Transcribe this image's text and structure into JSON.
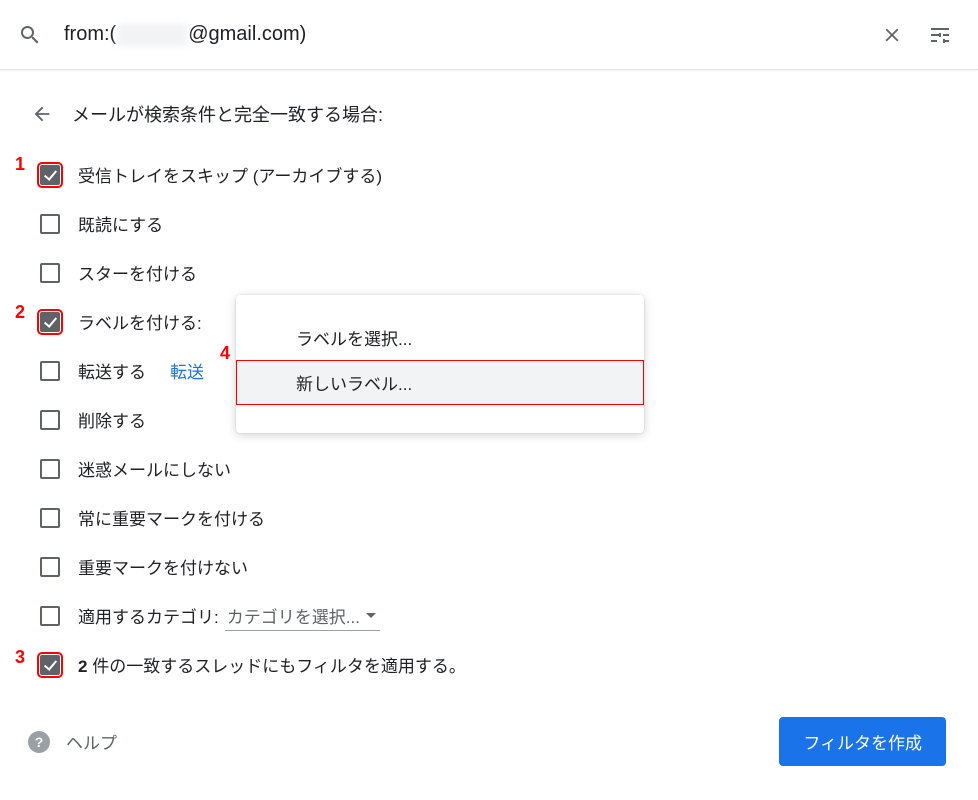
{
  "search": {
    "prefix": "from:(",
    "suffix": "@gmail.com)",
    "clear_label": "clear",
    "options_label": "search-options"
  },
  "header": {
    "back_label": "back",
    "title": "メールが検索条件と完全一致する場合:"
  },
  "options": {
    "skip_inbox": "受信トレイをスキップ (アーカイブする)",
    "mark_read": "既読にする",
    "star": "スターを付ける",
    "label": "ラベルを付ける:",
    "forward": "転送する",
    "forward_link": "転送",
    "delete": "削除する",
    "not_spam": "迷惑メールにしない",
    "always_important": "常に重要マークを付ける",
    "never_important": "重要マークを付けない",
    "category": "適用するカテゴリ:",
    "category_select": "カテゴリを選択...",
    "also_apply_prefix": "2",
    "also_apply_suffix": " 件の一致するスレッドにもフィルタを適用する。"
  },
  "dropdown": {
    "choose_label": "ラベルを選択...",
    "new_label": "新しいラベル..."
  },
  "footer": {
    "help": "ヘルプ",
    "create": "フィルタを作成"
  },
  "annotations": {
    "one": "1",
    "two": "2",
    "three": "3",
    "four": "4"
  }
}
